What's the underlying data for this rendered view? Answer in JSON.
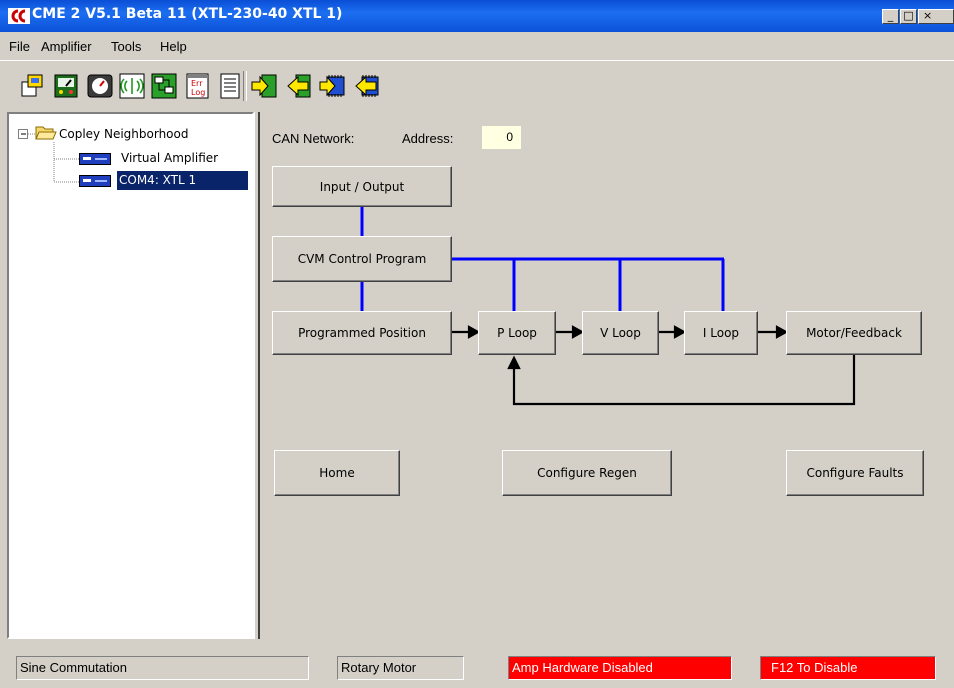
{
  "window": {
    "title": "CME 2  V5.1 Beta 11   (XTL-230-40  XTL 1)",
    "controls": {
      "minimize": "_",
      "maximize": "□",
      "close": "×"
    }
  },
  "menu": [
    "File",
    "Amplifier",
    "Tools",
    "Help"
  ],
  "toolbar": {
    "icons": [
      "amplifier-setup-icon",
      "control-panel-icon",
      "scope-icon",
      "tuning-icon",
      "ccx-editor-icon",
      "error-log-icon",
      "notes-icon",
      "save-to-disk-icon",
      "restore-from-disk-icon",
      "save-to-flash-icon",
      "restore-from-flash-icon"
    ],
    "err_label_top": "Err",
    "err_label_bottom": "Log"
  },
  "tree": {
    "root": "Copley Neighborhood",
    "children": [
      "Virtual Amplifier",
      "COM4: XTL 1"
    ],
    "selected_index": 1
  },
  "panel": {
    "can_label": "CAN Network:",
    "address_label": "Address:",
    "address_value": "0",
    "buttons": {
      "input_output": "Input / Output",
      "cvm": "CVM Control Program",
      "programmed_position": "Programmed Position",
      "p_loop": "P Loop",
      "v_loop": "V Loop",
      "i_loop": "I Loop",
      "motor_feedback": "Motor/Feedback",
      "home": "Home",
      "configure_regen": "Configure Regen",
      "configure_faults": "Configure Faults"
    }
  },
  "status": {
    "commutation": "Sine Commutation",
    "motor_type": "Rotary Motor",
    "hardware": "Amp Hardware Disabled",
    "hotkey": "F12 To Disable"
  },
  "colors": {
    "link_blue": "#0000ff",
    "status_red": "#ff0000",
    "address_bg": "#ffffe1",
    "selection": "#0a246a"
  }
}
